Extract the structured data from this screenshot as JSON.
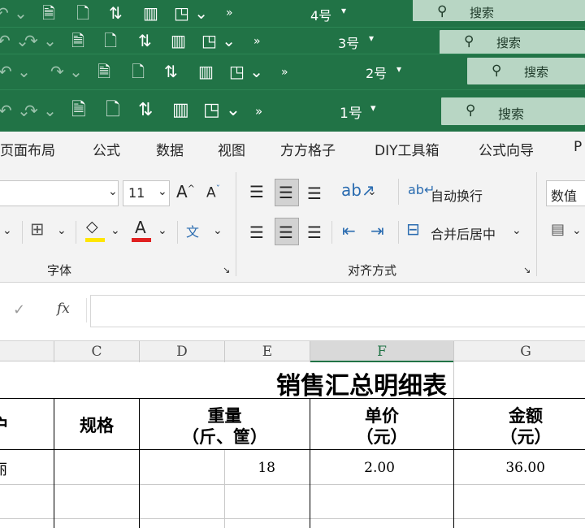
{
  "windows": [
    {
      "doc_title": "4号",
      "search_label": "搜索"
    },
    {
      "doc_title": "3号",
      "search_label": "搜索"
    },
    {
      "doc_title": "2号",
      "search_label": "搜索"
    },
    {
      "doc_title": "1号",
      "search_label": "搜索"
    }
  ],
  "icons": [
    "undo-icon",
    "redo-icon",
    "save-icon",
    "new-file-icon",
    "sort-icon",
    "chart-icon",
    "shapes-icon",
    "more-icon",
    "search-icon"
  ],
  "ribbon_tabs": [
    "页面布局",
    "公式",
    "数据",
    "视图",
    "方方格子",
    "DIY工具箱",
    "公式向导",
    "P"
  ],
  "font_group": {
    "font_size": "11",
    "label": "字体"
  },
  "align_group": {
    "wrap_text": "自动换行",
    "merge_center": "合并后居中",
    "label": "对齐方式"
  },
  "number_group": {
    "format": "数值"
  },
  "formula_bar": {
    "fx": "fx",
    "value": ""
  },
  "columns": [
    "C",
    "D",
    "E",
    "F",
    "G"
  ],
  "selected_column": "F",
  "sheet": {
    "title": "销售汇总明细表",
    "header_partial": "户",
    "header_spec": "规格",
    "header_weight_1": "重量",
    "header_weight_2": "（斤、筐）",
    "header_price_1": "单价",
    "header_price_2": "（元）",
    "header_amount_1": "金额",
    "header_amount_2": "（元）",
    "row1_partial": "丽",
    "row1_weight": "18",
    "row1_price": "2.00",
    "row1_amount": "36.00"
  },
  "colors": {
    "title_bar": "#217346",
    "search_box": "#b8d6c4",
    "ribbon_bg": "#f3f3f3",
    "fill_color_underline": "#ffe600",
    "font_color_underline": "#e02020"
  }
}
